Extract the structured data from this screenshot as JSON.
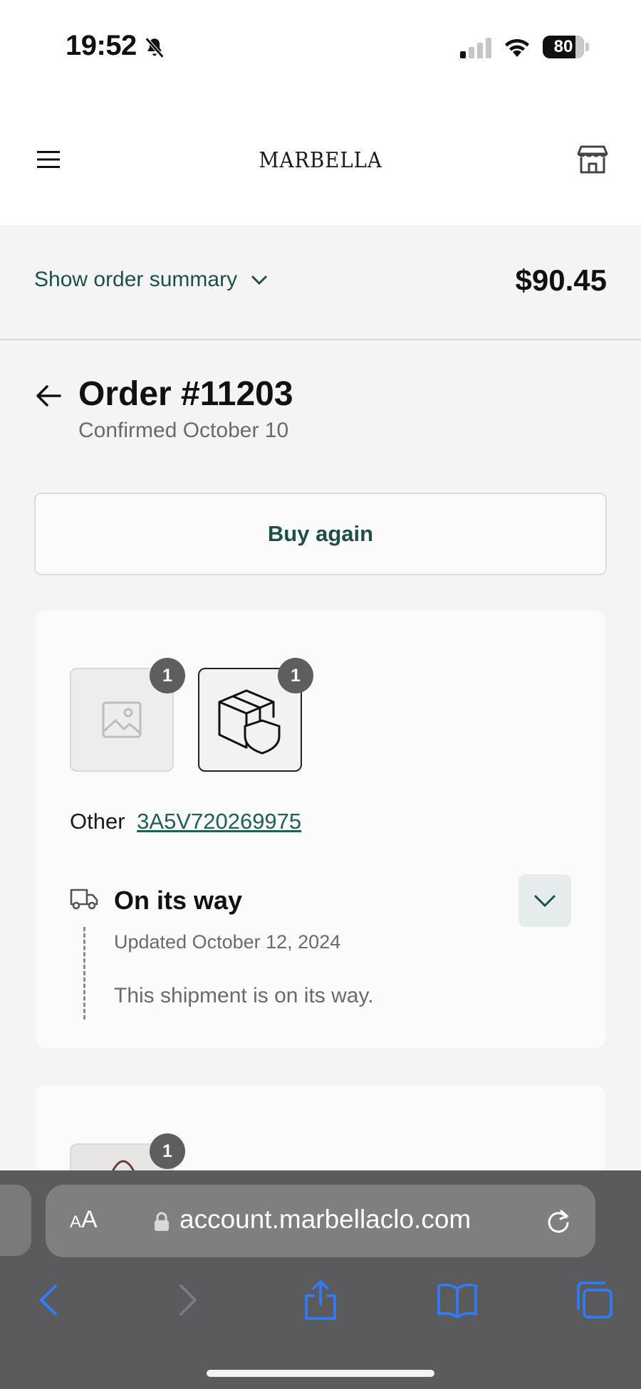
{
  "status_bar": {
    "time": "19:52",
    "battery": "80"
  },
  "header": {
    "brand": "MARBELLA"
  },
  "summary": {
    "toggle_label": "Show order summary",
    "total": "$90.45"
  },
  "order": {
    "title": "Order #11203",
    "subtitle": "Confirmed October 10",
    "buy_again_label": "Buy again"
  },
  "shipment": {
    "items": [
      {
        "qty": "1"
      },
      {
        "qty": "1"
      }
    ],
    "carrier_label": "Other",
    "tracking_number": "3A5V720269975",
    "status_title": "On its way",
    "updated": "Updated October 12, 2024",
    "message": "This shipment is on its way."
  },
  "shipment2": {
    "items": [
      {
        "qty": "1"
      }
    ]
  },
  "browser": {
    "text_size_label": "AA",
    "url": "account.marbellaclo.com"
  }
}
